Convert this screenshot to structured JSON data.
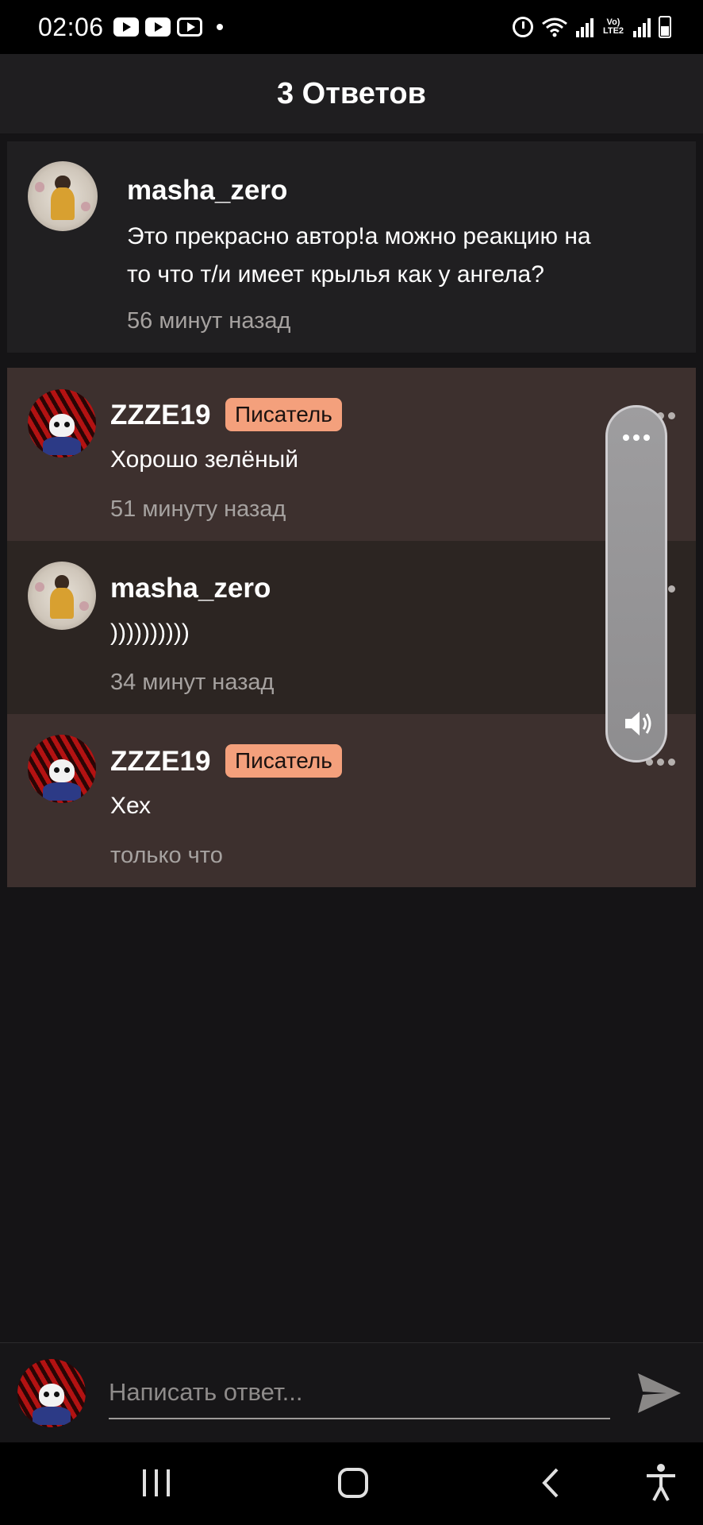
{
  "status_bar": {
    "time": "02:06",
    "network_label": "Vo) LTE2"
  },
  "header": {
    "title": "3 Ответов"
  },
  "original_comment": {
    "username": "masha_zero",
    "text_line1": "Это прекрасно автор!а можно реакцию на",
    "text_line2": "то что т/и имеет крылья как у ангела?",
    "timestamp": "56 минут назад"
  },
  "replies": [
    {
      "username": "ZZZE19",
      "badge": "Писатель",
      "text": "Хорошо зелёный",
      "timestamp": "51 минуту назад"
    },
    {
      "username": "masha_zero",
      "badge": "",
      "text": "))))))))))",
      "timestamp": "34 минут назад"
    },
    {
      "username": "ZZZE19",
      "badge": "Писатель",
      "text": "Хех",
      "timestamp": "только что"
    }
  ],
  "reply_bar": {
    "placeholder": "Написать ответ..."
  },
  "colors": {
    "badge_bg": "#f4a07c",
    "reply_bg": "#3d302e",
    "page_bg": "#151416"
  },
  "icons": {
    "status": [
      "youtube-icon",
      "youtube-icon",
      "youtube-framed-icon",
      "notification-dot-icon",
      "alarm-icon",
      "wifi-icon",
      "signal-icon",
      "battery-icon"
    ],
    "comment": [
      "more-options-icon"
    ],
    "volume": [
      "more-options-icon",
      "speaker-icon"
    ],
    "reply": [
      "send-icon"
    ],
    "nav": [
      "recent-apps-icon",
      "home-icon",
      "back-icon",
      "accessibility-icon"
    ]
  }
}
